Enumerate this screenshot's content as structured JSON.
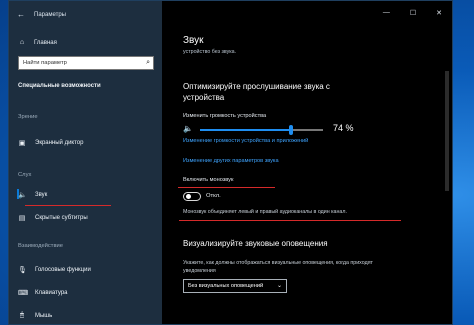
{
  "window": {
    "title": "Параметры",
    "controls": {
      "minimize": "—",
      "maximize": "☐",
      "close": "✕"
    }
  },
  "sidebar": {
    "back_icon": "←",
    "home_label": "Главная",
    "search_placeholder": "Найти параметр",
    "section_title": "Специальные возможности",
    "groups": [
      {
        "label": "Зрение",
        "items": [
          {
            "label": "Экранный диктор",
            "icon": "narrator-icon"
          }
        ]
      },
      {
        "label": "Слух",
        "items": [
          {
            "label": "Звук",
            "icon": "speaker-icon",
            "selected": true
          },
          {
            "label": "Скрытые субтитры",
            "icon": "captions-icon"
          }
        ]
      },
      {
        "label": "Взаимодействие",
        "items": [
          {
            "label": "Голосовые функции",
            "icon": "microphone-icon"
          },
          {
            "label": "Клавиатура",
            "icon": "keyboard-icon"
          },
          {
            "label": "Мышь",
            "icon": "mouse-icon"
          }
        ]
      }
    ]
  },
  "main": {
    "title": "Звук",
    "subtitle": "устройство без звука.",
    "optimize_heading": "Оптимизируйте прослушивание звука с устройства",
    "volume_label": "Изменить громкость устройства",
    "volume_value": "74 %",
    "volume_level": 0.74,
    "link_app_volume": "Изменение громкости устройства и приложений",
    "link_other_sound": "Изменение других параметров звука",
    "mono_label": "Включить монозвук",
    "mono_state": "Откл.",
    "mono_description": "Монозвук объединяет левый и правый аудиоканалы в один канал.",
    "visual_heading": "Визуализируйте звуковые оповещения",
    "visual_help": "Укажите, как должны отображаться визуальные оповещения, когда приходят уведомления",
    "visual_select": "Без визуальных оповещений",
    "accent": "#1f8ef1",
    "highlight": "#d52a2a"
  }
}
